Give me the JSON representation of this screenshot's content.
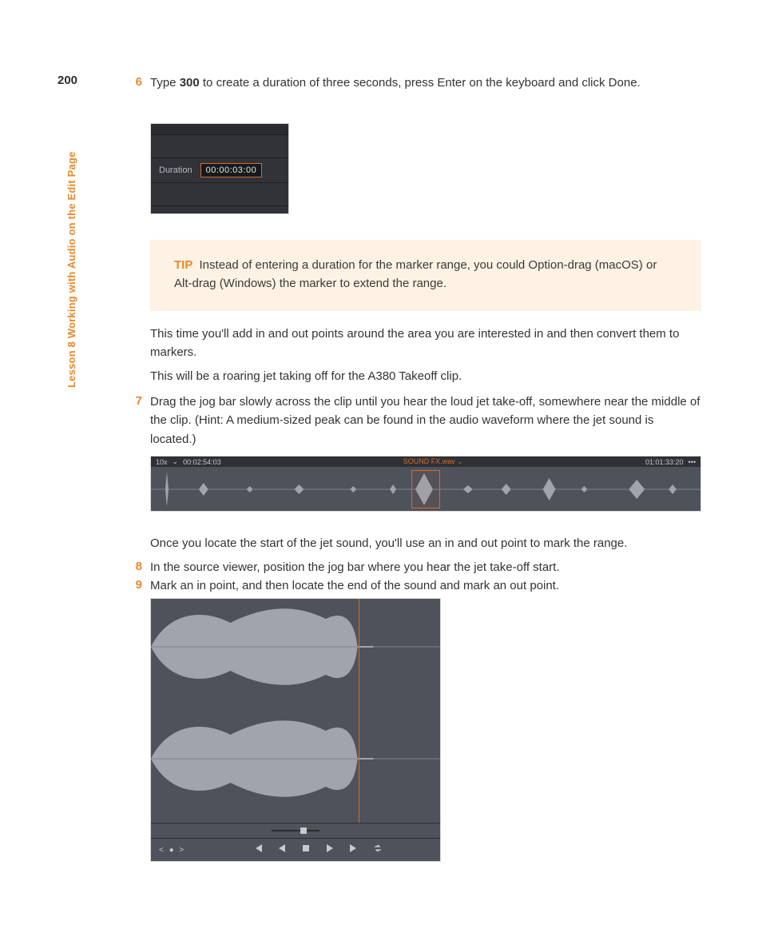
{
  "page_number": "200",
  "side_label": "Lesson 8   Working with Audio on the Edit Page",
  "step6": {
    "num": "6",
    "text_pre": "Type ",
    "text_bold": "300",
    "text_post": " to create a duration of three seconds, press Enter on the keyboard and click Done."
  },
  "duration_panel": {
    "label": "Duration",
    "value": "00:00:03:00"
  },
  "tip": {
    "label": "TIP",
    "text": "  Instead of entering a duration for the marker range, you could Option-drag (macOS) or Alt-drag (Windows) the marker to extend the range."
  },
  "para_after_tip_1": "This time you'll add in and out points around the area you are interested in and then convert them to markers.",
  "para_after_tip_2": "This will be a roaring jet taking off for the A380 Takeoff clip.",
  "step7": {
    "num": "7",
    "text": "Drag the jog bar slowly across the clip until you hear the loud jet take-off, somewhere near the middle of the clip. (Hint: A medium-sized peak can be found in the audio waveform where the jet sound is located.)"
  },
  "wave_viewer": {
    "zoom": "10x",
    "tc_left": "00:02:54:03",
    "clip_name": "SOUND FX.wav",
    "tc_right": "01:01:33:20"
  },
  "para_after_wave": "Once you locate the start of the jet sound, you'll use an in and out point to mark the range.",
  "step8": {
    "num": "8",
    "text": "In the source viewer, position the jog bar where you hear the jet take-off start."
  },
  "step9": {
    "num": "9",
    "text": "Mark an in point, and then locate the end of the sound and mark an out point."
  },
  "transport_nav": "<  ●  >"
}
